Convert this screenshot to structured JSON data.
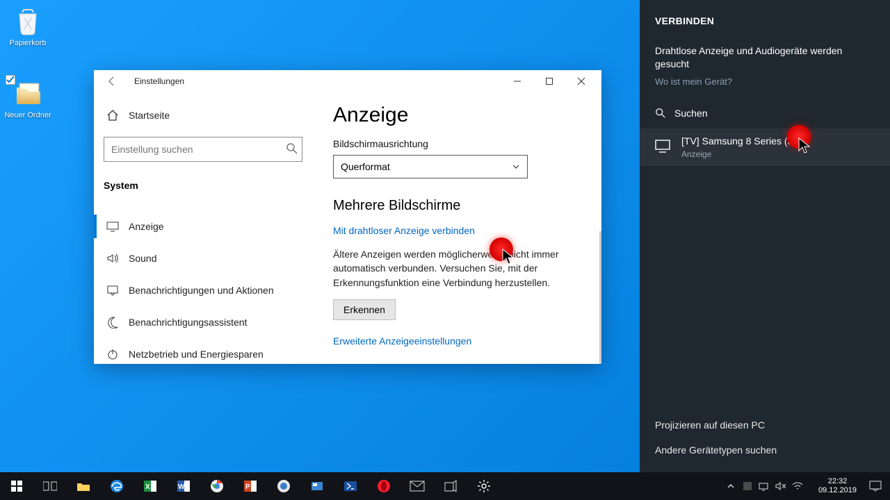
{
  "desktop": {
    "recycle_label": "Papierkorb",
    "newfolder_label": "Neuer Ordner"
  },
  "window": {
    "title": "Einstellungen",
    "home_label": "Startseite",
    "search_placeholder": "Einstellung suchen",
    "category": "System",
    "nav": [
      {
        "label": "Anzeige"
      },
      {
        "label": "Sound"
      },
      {
        "label": "Benachrichtigungen und Aktionen"
      },
      {
        "label": "Benachrichtigungsassistent"
      },
      {
        "label": "Netzbetrieb und Energiesparen"
      }
    ]
  },
  "content": {
    "heading": "Anzeige",
    "orientation_label": "Bildschirmausrichtung",
    "orientation_value": "Querformat",
    "multi_heading": "Mehrere Bildschirme",
    "wireless_link": "Mit drahtloser Anzeige verbinden",
    "info_text": "Ältere Anzeigen werden möglicherweise nicht immer automatisch verbunden. Versuchen Sie, mit der Erkennungsfunktion eine Verbindung herzustellen.",
    "detect_label": "Erkennen",
    "advanced_link": "Erweiterte Anzeigeeinstellungen"
  },
  "connect": {
    "title": "VERBINDEN",
    "searching_text": "Drahtlose Anzeige und Audiogeräte werden gesucht",
    "where_text": "Wo ist mein Gerät?",
    "search_label": "Suchen",
    "device_name": "[TV] Samsung 8 Series (55)",
    "device_type": "Anzeige",
    "project_link": "Projizieren auf diesen PC",
    "other_types_link": "Andere Gerätetypen suchen"
  },
  "taskbar": {
    "time": "22:32",
    "date": "09.12.2019"
  }
}
